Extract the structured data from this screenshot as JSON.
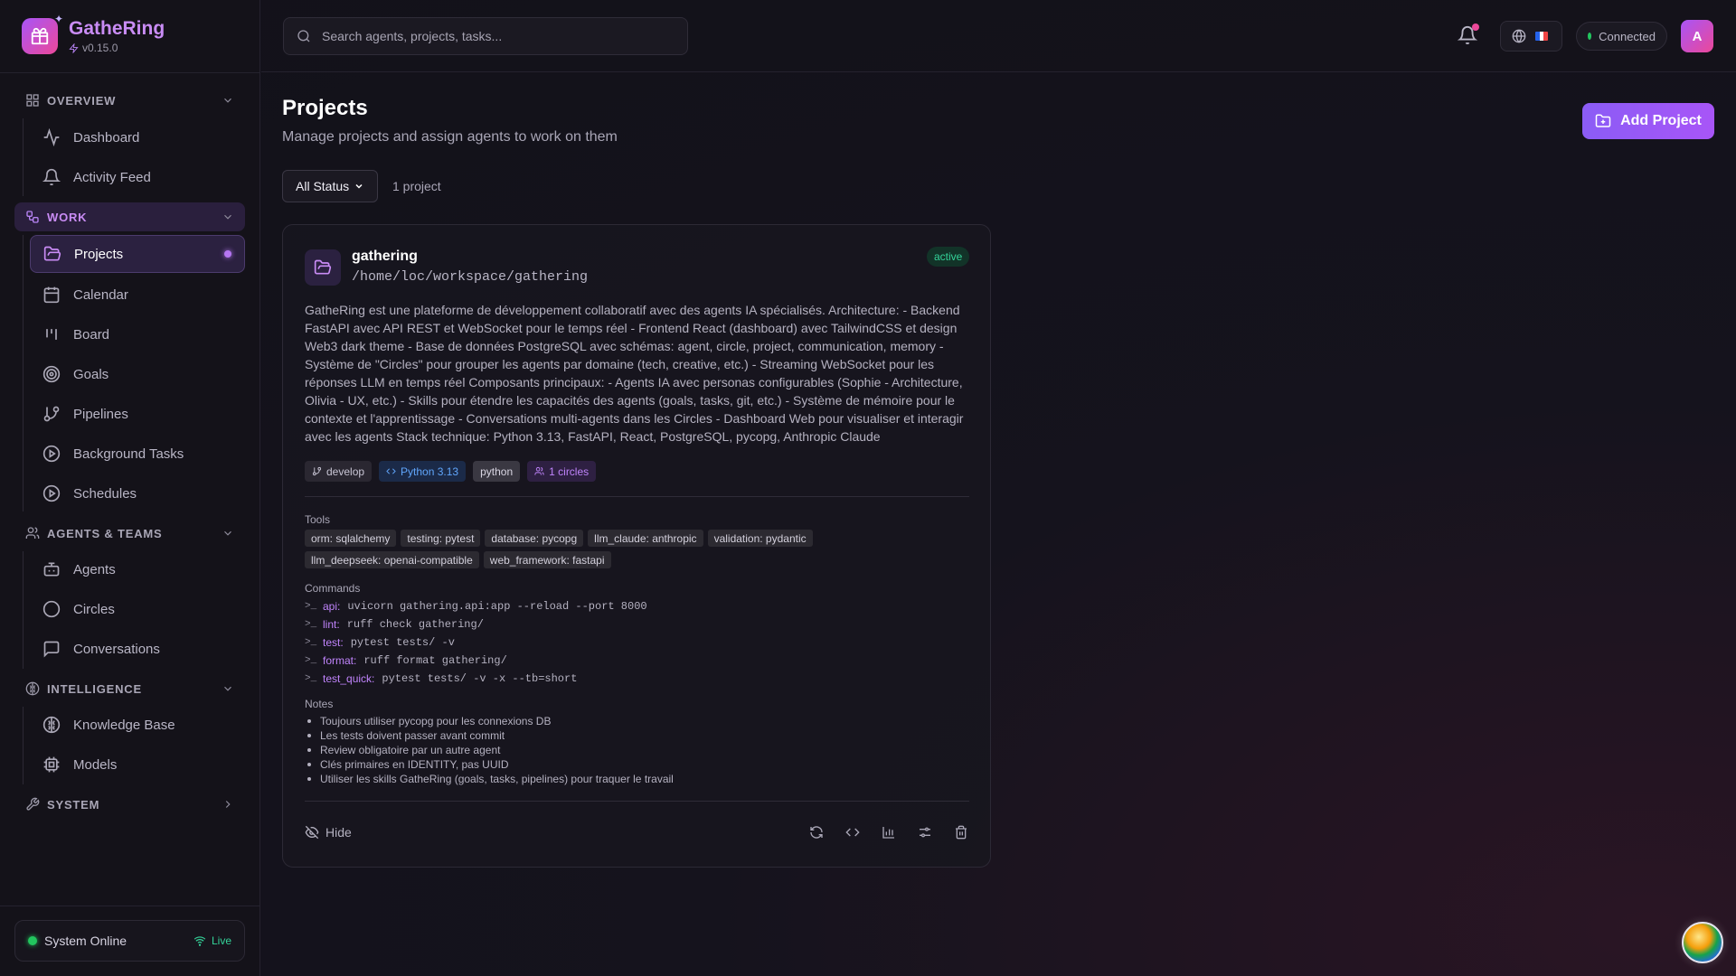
{
  "app": {
    "name": "GatheRing",
    "version": "v0.15.0"
  },
  "sidebar": {
    "sections": [
      {
        "label": "OVERVIEW",
        "items": [
          {
            "label": "Dashboard"
          },
          {
            "label": "Activity Feed"
          }
        ]
      },
      {
        "label": "WORK",
        "items": [
          {
            "label": "Projects"
          },
          {
            "label": "Calendar"
          },
          {
            "label": "Board"
          },
          {
            "label": "Goals"
          },
          {
            "label": "Pipelines"
          },
          {
            "label": "Background Tasks"
          },
          {
            "label": "Schedules"
          }
        ]
      },
      {
        "label": "AGENTS & TEAMS",
        "items": [
          {
            "label": "Agents"
          },
          {
            "label": "Circles"
          },
          {
            "label": "Conversations"
          }
        ]
      },
      {
        "label": "INTELLIGENCE",
        "items": [
          {
            "label": "Knowledge Base"
          },
          {
            "label": "Models"
          }
        ]
      },
      {
        "label": "SYSTEM"
      }
    ],
    "status": {
      "label": "System Online",
      "live": "Live"
    }
  },
  "topbar": {
    "search_placeholder": "Search agents, projects, tasks...",
    "connection": "Connected",
    "avatar_initial": "A"
  },
  "page": {
    "title": "Projects",
    "subtitle": "Manage projects and assign agents to work on them",
    "add_button": "Add Project",
    "filter_value": "All Status",
    "count": "1 project"
  },
  "project": {
    "name": "gathering",
    "path": "/home/loc/workspace/gathering",
    "status": "active",
    "description": "GatheRing est une plateforme de développement collaboratif avec des agents IA spécialisés. Architecture: - Backend FastAPI avec API REST et WebSocket pour le temps réel - Frontend React (dashboard) avec TailwindCSS et design Web3 dark theme - Base de données PostgreSQL avec schémas: agent, circle, project, communication, memory - Système de \"Circles\" pour grouper les agents par domaine (tech, creative, etc.) - Streaming WebSocket pour les réponses LLM en temps réel Composants principaux: - Agents IA avec personas configurables (Sophie - Architecture, Olivia - UX, etc.) - Skills pour étendre les capacités des agents (goals, tasks, git, etc.) - Système de mémoire pour le contexte et l'apprentissage - Conversations multi-agents dans les Circles - Dashboard Web pour visualiser et interagir avec les agents Stack technique: Python 3.13, FastAPI, React, PostgreSQL, pycopg, Anthropic Claude",
    "tags": {
      "branch": "develop",
      "runtime": "Python 3.13",
      "language": "python",
      "circles": "1 circles"
    },
    "tools_label": "Tools",
    "tools": [
      "orm: sqlalchemy",
      "testing: pytest",
      "database: pycopg",
      "llm_claude: anthropic",
      "validation: pydantic",
      "llm_deepseek: openai-compatible",
      "web_framework: fastapi"
    ],
    "commands_label": "Commands",
    "commands": [
      {
        "name": "api:",
        "value": "uvicorn gathering.api:app --reload --port 8000"
      },
      {
        "name": "lint:",
        "value": "ruff check gathering/"
      },
      {
        "name": "test:",
        "value": "pytest tests/ -v"
      },
      {
        "name": "format:",
        "value": "ruff format gathering/"
      },
      {
        "name": "test_quick:",
        "value": "pytest tests/ -v -x --tb=short"
      }
    ],
    "notes_label": "Notes",
    "notes": [
      "Toujours utiliser pycopg pour les connexions DB",
      "Les tests doivent passer avant commit",
      "Review obligatoire par un autre agent",
      "Clés primaires en IDENTITY, pas UUID",
      "Utiliser les skills GatheRing (goals, tasks, pipelines) pour traquer le travail"
    ],
    "hide_label": "Hide"
  },
  "colors": {
    "accent": "#a855f7",
    "brand": "#c98cf5",
    "online": "#22c55e",
    "active": "#34d399"
  }
}
